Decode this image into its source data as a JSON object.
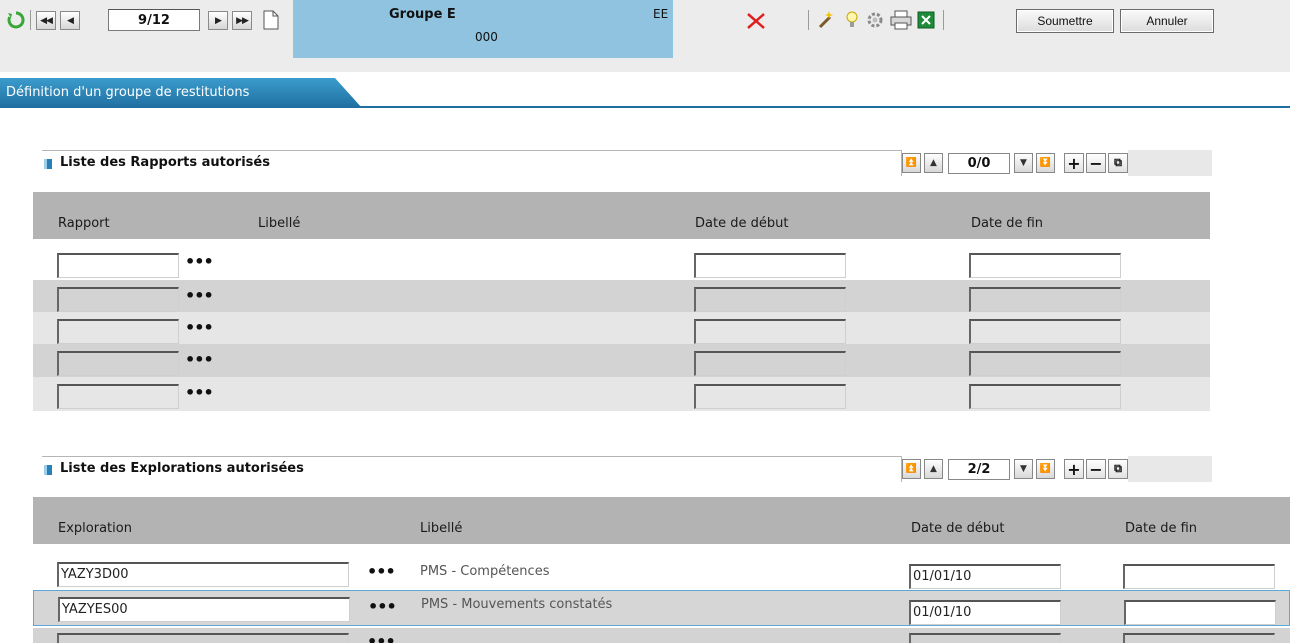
{
  "toolbar": {
    "record_position": "9/12",
    "header": {
      "name": "Groupe E",
      "code": "EE",
      "number": "000"
    },
    "submit_label": "Soumettre",
    "cancel_label": "Annuler",
    "icons": [
      "refresh-icon",
      "first-icon",
      "prev-icon",
      "next-icon",
      "last-icon",
      "new-page-icon",
      "delete-icon",
      "wand-icon",
      "bulb-icon",
      "settings-icon",
      "print-icon",
      "excel-icon"
    ],
    "colors": {
      "header_box": "#8fc3df",
      "delete": "#e02020",
      "refresh": "#3aa63a"
    }
  },
  "tab": {
    "label": "Définition d'un groupe de restitutions"
  },
  "reports": {
    "title": "Liste des Rapports autorisés",
    "count": "0/0",
    "columns": {
      "code": "Rapport",
      "label": "Libellé",
      "start": "Date de début",
      "end": "Date de fin"
    },
    "rows": [
      {
        "code": "",
        "dots": "•••",
        "label": "",
        "start": "",
        "end": ""
      },
      {
        "code": "",
        "dots": "•••",
        "label": "",
        "start": "",
        "end": ""
      },
      {
        "code": "",
        "dots": "•••",
        "label": "",
        "start": "",
        "end": ""
      },
      {
        "code": "",
        "dots": "•••",
        "label": "",
        "start": "",
        "end": ""
      },
      {
        "code": "",
        "dots": "•••",
        "label": "",
        "start": "",
        "end": ""
      }
    ]
  },
  "explorations": {
    "title": "Liste des Explorations autorisées",
    "count": "2/2",
    "columns": {
      "code": "Exploration",
      "label": "Libellé",
      "start": "Date de début",
      "end": "Date de fin"
    },
    "rows": [
      {
        "code": "YAZY3D00",
        "dots": "•••",
        "label": "PMS - Compétences",
        "start": "01/01/10",
        "end": ""
      },
      {
        "code": "YAZYES00",
        "dots": "•••",
        "label": "PMS - Mouvements constatés",
        "start": "01/01/10",
        "end": ""
      },
      {
        "code": "",
        "dots": "•••",
        "label": "",
        "start": "",
        "end": ""
      }
    ]
  }
}
